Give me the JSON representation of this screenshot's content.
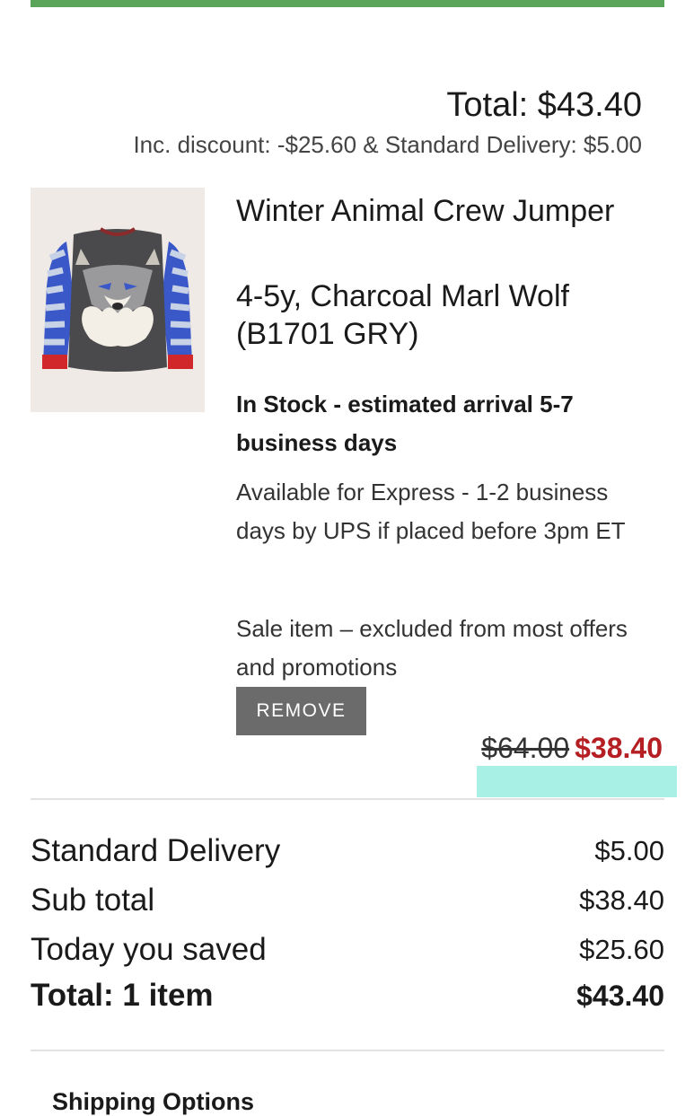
{
  "colors": {
    "progress": "#5aa55a",
    "sale_price": "#b51e22",
    "remove_button": "#6b6b6b",
    "highlight": "#a8f0e6"
  },
  "cart_header": {
    "total": "Total: $43.40",
    "discount_line": "Inc. discount: -$25.60 & Standard Delivery: $5.00"
  },
  "item": {
    "image_icon": "wolf-jumper-product-image",
    "title": "Winter Animal Crew Jumper",
    "variant": "4-5y, Charcoal Marl Wolf (B1701 GRY)",
    "stock": "In Stock - estimated arrival 5-7 business days",
    "express": "Available for Express - 1-2 business days by UPS if placed before 3pm ET",
    "sale_note": "Sale item – excluded from most offers and promotions",
    "remove_label": "REMOVE",
    "original_price": "$64.00",
    "sale_price": "$38.40"
  },
  "summary": {
    "delivery_label": "Standard Delivery",
    "delivery_value": "$5.00",
    "subtotal_label": "Sub total",
    "subtotal_value": "$38.40",
    "saved_label": "Today you saved",
    "saved_value": "$25.60",
    "total_label": "Total: 1 item",
    "total_value": "$43.40"
  },
  "shipping": {
    "heading": "Shipping Options"
  }
}
